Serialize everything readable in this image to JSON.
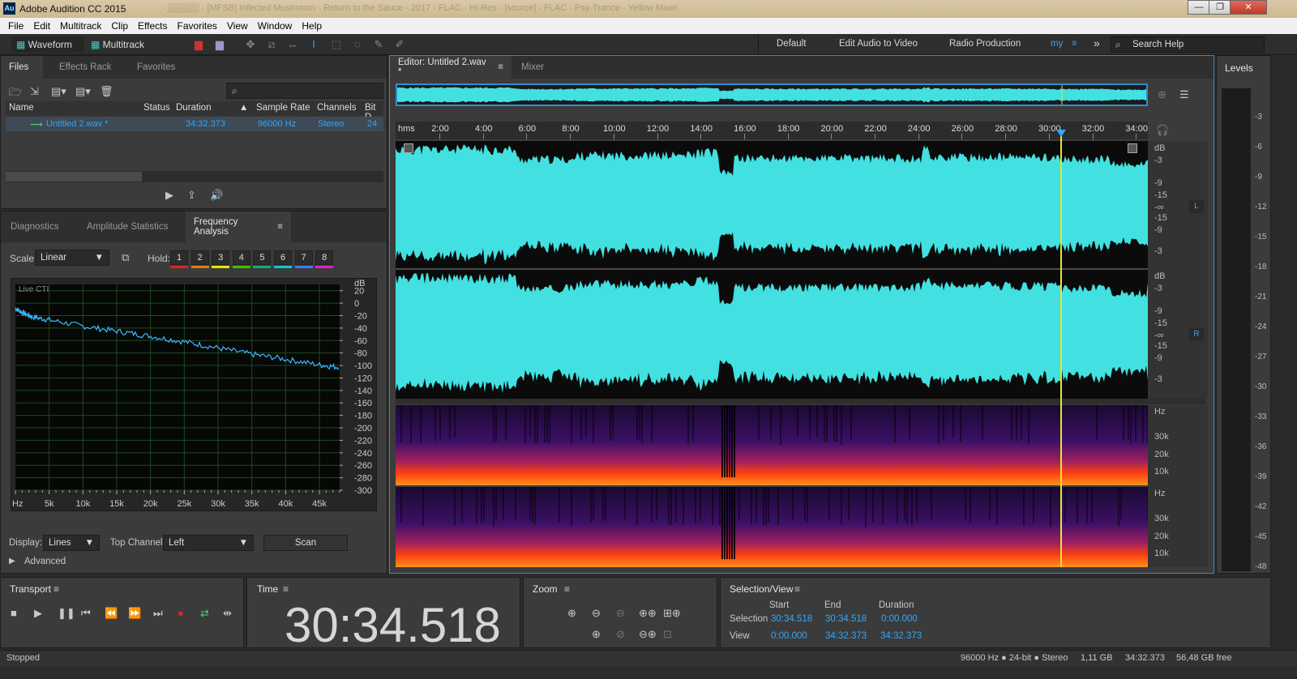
{
  "window": {
    "title": "Adobe Audition CC 2015",
    "faded_title": "- ▒▒▒▒▒ - [MFSB] Infected Mushroom - Return to the Sauce - 2017 - FLAC - Hi-Res - [source] - FLAC - Psy-Trance - Yellow Mixer",
    "icon_text": "Au",
    "minimize": "—",
    "maximize": "❐",
    "close": "✕"
  },
  "menu": [
    "File",
    "Edit",
    "Multitrack",
    "Clip",
    "Effects",
    "Favorites",
    "View",
    "Window",
    "Help"
  ],
  "toolbar": {
    "waveform": "Waveform",
    "multitrack": "Multitrack",
    "workspaces": [
      "Default",
      "Edit Audio to Video",
      "Radio Production"
    ],
    "workspace_current": "my",
    "more": "»",
    "search_placeholder": "Search Help"
  },
  "files_panel": {
    "tabs": [
      "Files",
      "Effects Rack",
      "Favorites"
    ],
    "search_icon": "search-icon",
    "columns": [
      "Name",
      "Status",
      "Duration",
      "Sample Rate",
      "Channels",
      "Bit D"
    ],
    "rows": [
      {
        "name": "Untitled 2.wav *",
        "status": "",
        "duration": "34:32.373",
        "sample_rate": "96000 Hz",
        "channels": "Stereo",
        "bit": "24"
      }
    ]
  },
  "analysis_panel": {
    "tabs": [
      "Diagnostics",
      "Amplitude Statistics",
      "Frequency Analysis"
    ],
    "scale_label": "Scale:",
    "scale_value": "Linear",
    "hold_label": "Hold:",
    "holds": [
      "1",
      "2",
      "3",
      "4",
      "5",
      "6",
      "7",
      "8"
    ],
    "hold_colors": [
      "#e02020",
      "#e07c10",
      "#e6e600",
      "#40c000",
      "#10b070",
      "#10c8d8",
      "#3a7bff",
      "#e020c8"
    ],
    "graph_label": "Live CTI",
    "display_label": "Display:",
    "display_value": "Lines",
    "top_channel_label": "Top Channel:",
    "top_channel_value": "Left",
    "scan": "Scan",
    "advanced": "Advanced"
  },
  "chart_data": {
    "type": "line",
    "title": "",
    "xlabel": "Hz",
    "ylabel": "dB",
    "x_ticks": [
      "5k",
      "10k",
      "15k",
      "20k",
      "25k",
      "30k",
      "35k",
      "40k",
      "45k"
    ],
    "y_ticks": [
      "20",
      "0",
      "-20",
      "-40",
      "-60",
      "-80",
      "-100",
      "-120",
      "-140",
      "-160",
      "-180",
      "-200",
      "-220",
      "-240",
      "-260",
      "-280",
      "-300"
    ],
    "xlim": [
      0,
      48000
    ],
    "ylim": [
      -300,
      30
    ],
    "series": [
      {
        "x": [
          0,
          1000,
          2500,
          5000,
          10000,
          15000,
          20000,
          25000,
          30000,
          35000,
          40000,
          45000,
          48000
        ],
        "y": [
          -8,
          -15,
          -22,
          -27,
          -37,
          -45,
          -53,
          -62,
          -72,
          -82,
          -90,
          -99,
          -103
        ]
      }
    ]
  },
  "editor": {
    "tabs": [
      "Editor: Untitled 2.wav *",
      "Mixer"
    ],
    "ruler_unit": "hms",
    "ruler": [
      "2:00",
      "4:00",
      "6:00",
      "8:00",
      "10:00",
      "12:00",
      "14:00",
      "16:00",
      "18:00",
      "20:00",
      "22:00",
      "24:00",
      "26:00",
      "28:00",
      "30:00",
      "32:00",
      "34:00"
    ],
    "db_scale": [
      "dB",
      "-3",
      "-9",
      "-15",
      "-∞",
      "-15",
      "-9",
      "-3"
    ],
    "channel_L": "L",
    "channel_R": "R",
    "hz_scale": [
      "Hz",
      "30k",
      "20k",
      "10k"
    ],
    "playhead_fraction": 0.884
  },
  "levels": {
    "title": "Levels",
    "scale": [
      "-3",
      "-6",
      "-9",
      "-12",
      "-15",
      "-18",
      "-21",
      "-24",
      "-27",
      "-30",
      "-33",
      "-36",
      "-39",
      "-42",
      "-45",
      "-48"
    ]
  },
  "transport": {
    "title": "Transport"
  },
  "time": {
    "title": "Time",
    "value": "30:34.518"
  },
  "zoom": {
    "title": "Zoom"
  },
  "selection": {
    "title": "Selection/View",
    "start": "Start",
    "end": "End",
    "duration": "Duration",
    "selection_label": "Selection",
    "sel_start": "30:34.518",
    "sel_end": "30:34.518",
    "sel_dur": "0:00.000",
    "view_label": "View",
    "view_start": "0:00.000",
    "view_end": "34:32.373",
    "view_dur": "34:32.373"
  },
  "status": {
    "left": "Stopped",
    "format": "96000 Hz ● 24-bit ● Stereo",
    "size": "1,11 GB",
    "duration": "34:32.373",
    "free": "56,48 GB free"
  }
}
